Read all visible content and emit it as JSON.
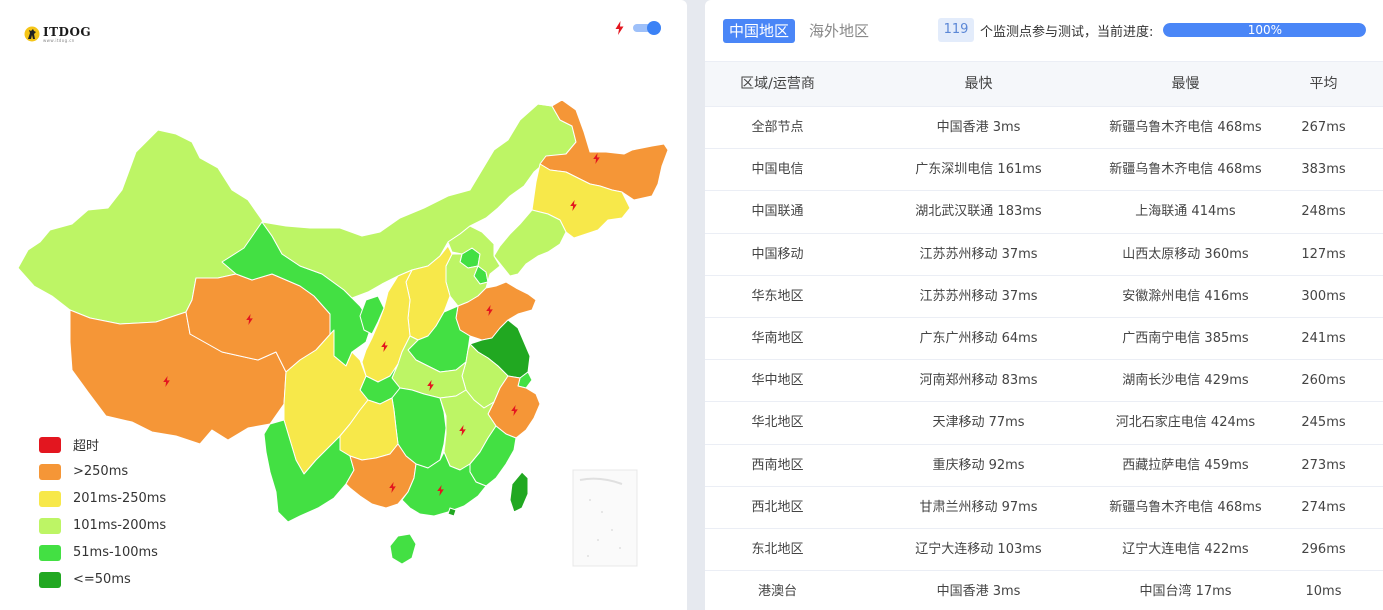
{
  "logo": {
    "name": "ITDOG",
    "url": "www.itdog.cn"
  },
  "map": {
    "legend": [
      {
        "label": "超时",
        "color": "#e3161f"
      },
      {
        "label": ">250ms",
        "color": "#f59637"
      },
      {
        "label": "201ms-250ms",
        "color": "#f7e84a"
      },
      {
        "label": "101ms-200ms",
        "color": "#bdf565"
      },
      {
        "label": "51ms-100ms",
        "color": "#43e043"
      },
      {
        "label": "<=50ms",
        "color": "#21a821"
      }
    ],
    "bolt_toggle_on": true,
    "colors": {
      "slow": "#f59637",
      "mid": "#f7e84a",
      "light": "#bdf565",
      "green": "#43e043",
      "dark": "#21a821",
      "timeout": "#e3161f"
    }
  },
  "tabs": {
    "active": "中国地区",
    "inactive": "海外地区"
  },
  "progress": {
    "count": "119",
    "label": "个监测点参与测试，当前进度:",
    "percent_text": "100%",
    "percent": 100
  },
  "table": {
    "headers": [
      "区域/运营商",
      "最快",
      "最慢",
      "平均"
    ],
    "rows": [
      [
        "全部节点",
        "中国香港 3ms",
        "新疆乌鲁木齐电信 468ms",
        "267ms"
      ],
      [
        "中国电信",
        "广东深圳电信 161ms",
        "新疆乌鲁木齐电信 468ms",
        "383ms"
      ],
      [
        "中国联通",
        "湖北武汉联通 183ms",
        "上海联通 414ms",
        "248ms"
      ],
      [
        "中国移动",
        "江苏苏州移动 37ms",
        "山西太原移动 360ms",
        "127ms"
      ],
      [
        "华东地区",
        "江苏苏州移动 37ms",
        "安徽滁州电信 416ms",
        "300ms"
      ],
      [
        "华南地区",
        "广东广州移动 64ms",
        "广西南宁电信 385ms",
        "241ms"
      ],
      [
        "华中地区",
        "河南郑州移动 83ms",
        "湖南长沙电信 429ms",
        "260ms"
      ],
      [
        "华北地区",
        "天津移动 77ms",
        "河北石家庄电信 424ms",
        "245ms"
      ],
      [
        "西南地区",
        "重庆移动 92ms",
        "西藏拉萨电信 459ms",
        "273ms"
      ],
      [
        "西北地区",
        "甘肃兰州移动 97ms",
        "新疆乌鲁木齐电信 468ms",
        "274ms"
      ],
      [
        "东北地区",
        "辽宁大连移动 103ms",
        "辽宁大连电信 422ms",
        "296ms"
      ],
      [
        "港澳台",
        "中国香港 3ms",
        "中国台湾 17ms",
        "10ms"
      ]
    ]
  }
}
